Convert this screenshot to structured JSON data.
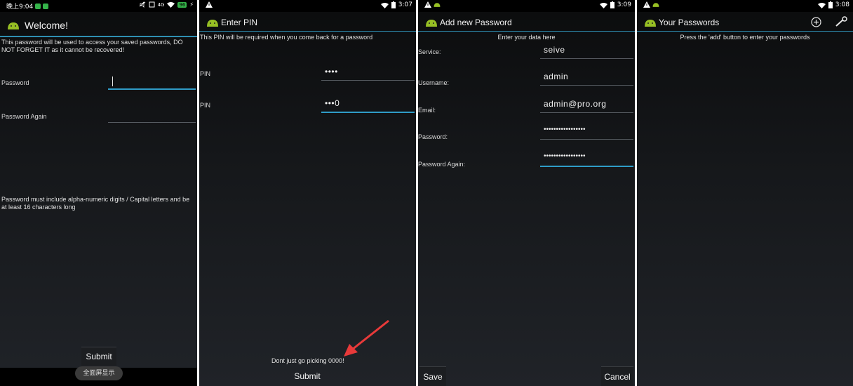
{
  "screens": [
    {
      "status": {
        "time": "晚上9:04",
        "battery": "96"
      },
      "title": "Welcome!",
      "intro": "This password will be used to access your saved passwords, DO NOT FORGET IT as it cannot be recovered!",
      "password_label": "Password",
      "password_again_label": "Password Again",
      "hint": "Password must include alpha-numeric digits / Capital letters and be at least 16 characters long",
      "submit_label": "Submit",
      "fullscreen_label": "全面屏显示"
    },
    {
      "status": {
        "time": "3:07"
      },
      "title": "Enter PIN",
      "intro": "This PIN will be required when you come back for a password",
      "pin_label_1": "PIN",
      "pin_value_1": "••••",
      "pin_label_2": "PIN",
      "pin_value_2": "•••0",
      "warning": "Dont just go picking 0000!",
      "submit_label": "Submit"
    },
    {
      "status": {
        "time": "3:09"
      },
      "title": "Add new Password",
      "intro": "Enter your data here",
      "service_label": "Service:",
      "service_value": "seive",
      "username_label": "Username:",
      "username_value": "admin",
      "email_label": "Email:",
      "email_value": "admin@pro.org",
      "password_label": "Password:",
      "password_value": "•••••••••••••••••",
      "password_again_label": "Password Again:",
      "password_again_value": "•••••••••••••••••",
      "save_label": "Save",
      "cancel_label": "Cancel"
    },
    {
      "status": {
        "time": "3:08"
      },
      "title": "Your Passwords",
      "intro": "Press the 'add' button to enter your passwords"
    }
  ],
  "colors": {
    "accent": "#2f9cc7",
    "arrow": "#e83a3a",
    "background": "#16181b"
  },
  "icons": [
    "app-logo-icon",
    "warning-icon",
    "wifi-icon",
    "battery-icon",
    "add-icon",
    "settings-wrench-icon",
    "arrow-annotation"
  ]
}
